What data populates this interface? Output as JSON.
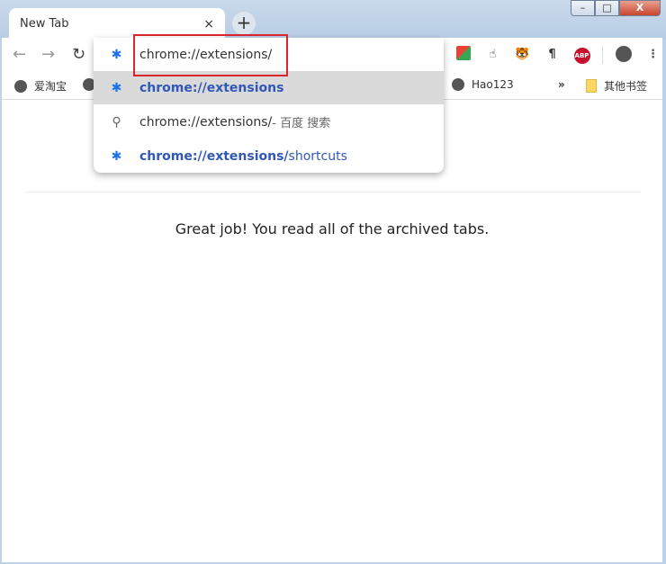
{
  "tab": {
    "title": "New Tab",
    "close": "×",
    "new_tab": "+"
  },
  "window_controls": {
    "minimize": "–",
    "maximize": "□",
    "close": "X"
  },
  "omnibox": {
    "value": "chrome://extensions/"
  },
  "suggestions": [
    {
      "icon": "puzzle-icon",
      "bold": "chrome://extensions",
      "rest": ""
    },
    {
      "icon": "search-icon",
      "text": "chrome://extensions/",
      "suffix": " - 百度 搜索"
    },
    {
      "icon": "puzzle-icon",
      "bold": "chrome://extensions/",
      "rest": "shortcuts"
    }
  ],
  "extensions": [
    "ABP"
  ],
  "bookmarks": {
    "items": [
      "爱淘宝",
      "Hao123"
    ],
    "overflow": "»",
    "other": "其他书签"
  },
  "content": {
    "message": "Great job! You read all of the archived tabs."
  },
  "colors": {
    "highlight": "#dadada",
    "link": "#3158b8",
    "annotation": "#d9262c"
  }
}
